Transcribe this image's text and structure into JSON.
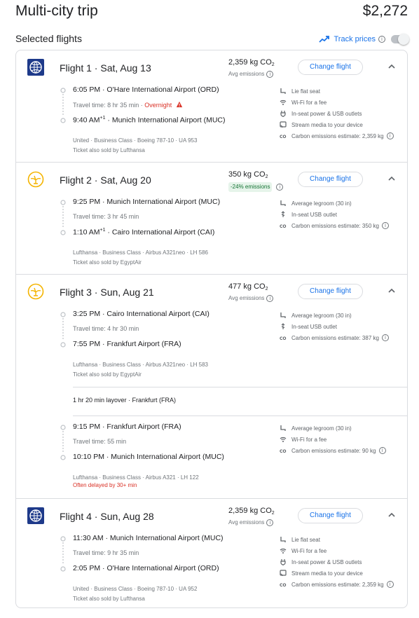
{
  "header": {
    "title": "Multi-city trip",
    "price": "$2,272"
  },
  "subheader": {
    "selected_label": "Selected flights",
    "track_label": "Track prices"
  },
  "change_label": "Change flight",
  "flights": [
    {
      "title": "Flight 1 · Sat, Aug 13",
      "airline_logo": "united-globe-icon",
      "emissions_value": "2,359 kg CO",
      "emissions_sub": "2",
      "emissions_note": "Avg emissions",
      "segments": [
        {
          "dep": "6:05 PM · O'Hare International Airport (ORD)",
          "travel": "Travel time: 8 hr 35 min · ",
          "overnight": "Overnight",
          "arr": "9:40 AM",
          "arr_sup": "+1",
          "arr_airport": " · Munich International Airport (MUC)",
          "meta1": "United · Business Class · Boeing 787-10 · UA 953",
          "meta2": "Ticket also sold by Lufthansa",
          "amenities": [
            "Lie flat seat",
            "Wi-Fi for a fee",
            "In-seat power & USB outlets",
            "Stream media to your device",
            "Carbon emissions estimate: 2,359 kg"
          ]
        }
      ]
    },
    {
      "title": "Flight 2 · Sat, Aug 20",
      "airline_logo": "lufthansa-crane-icon",
      "emissions_value": "350 kg CO",
      "emissions_sub": "2",
      "emissions_badge": "-24% emissions",
      "segments": [
        {
          "dep": "9:25 PM · Munich International Airport (MUC)",
          "travel": "Travel time: 3 hr 45 min",
          "arr": "1:10 AM",
          "arr_sup": "+1",
          "arr_airport": " · Cairo International Airport (CAI)",
          "meta1": "Lufthansa · Business Class · Airbus A321neo · LH 586",
          "meta2": "Ticket also sold by EgyptAir",
          "amenities": [
            "Average legroom (30 in)",
            "In-seat USB outlet",
            "Carbon emissions estimate: 350 kg"
          ]
        }
      ]
    },
    {
      "title": "Flight 3 · Sun, Aug 21",
      "airline_logo": "lufthansa-crane-icon",
      "emissions_value": "477 kg CO",
      "emissions_sub": "2",
      "emissions_note": "Avg emissions",
      "layover": "1 hr 20 min layover · Frankfurt (FRA)",
      "segments": [
        {
          "dep": "3:25 PM · Cairo International Airport (CAI)",
          "travel": "Travel time: 4 hr 30 min",
          "arr": "7:55 PM",
          "arr_airport": " · Frankfurt Airport (FRA)",
          "meta1": "Lufthansa · Business Class · Airbus A321neo · LH 583",
          "meta2": "Ticket also sold by EgyptAir",
          "amenities": [
            "Average legroom (30 in)",
            "In-seat USB outlet",
            "Carbon emissions estimate: 387 kg"
          ]
        },
        {
          "dep": "9:15 PM · Frankfurt Airport (FRA)",
          "travel": "Travel time: 55 min",
          "arr": "10:10 PM",
          "arr_airport": " · Munich International Airport (MUC)",
          "meta1": "Lufthansa · Business Class · Airbus A321 · LH 122",
          "delay": "Often delayed by 30+ min",
          "amenities": [
            "Average legroom (30 in)",
            "Wi-Fi for a fee",
            "Carbon emissions estimate: 90 kg"
          ]
        }
      ]
    },
    {
      "title": "Flight 4 · Sun, Aug 28",
      "airline_logo": "united-globe-icon",
      "emissions_value": "2,359 kg CO",
      "emissions_sub": "2",
      "emissions_note": "Avg emissions",
      "segments": [
        {
          "dep": "11:30 AM · Munich International Airport (MUC)",
          "travel": "Travel time: 9 hr 35 min",
          "arr": "2:05 PM",
          "arr_airport": " · O'Hare International Airport (ORD)",
          "meta1": "United · Business Class · Boeing 787-10 · UA 952",
          "meta2": "Ticket also sold by Lufthansa",
          "amenities": [
            "Lie flat seat",
            "Wi-Fi for a fee",
            "In-seat power & USB outlets",
            "Stream media to your device",
            "Carbon emissions estimate: 2,359 kg"
          ]
        }
      ]
    }
  ],
  "colors": {
    "accent": "#1a73e8",
    "warning": "#d93025",
    "success": "#137333",
    "border": "#dadce0",
    "united": "#1e3a8a",
    "lufthansa": "#f4b400"
  }
}
